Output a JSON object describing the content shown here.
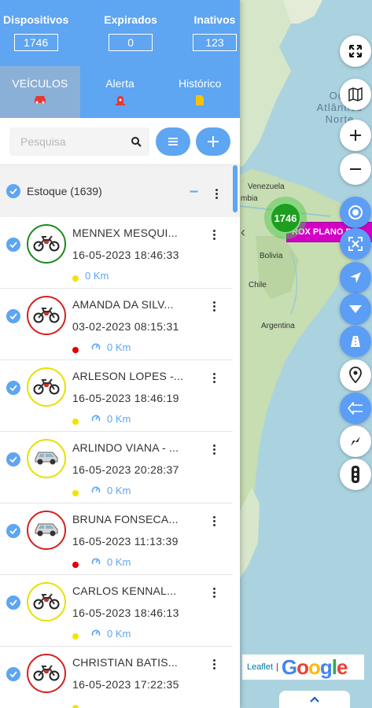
{
  "stats": [
    {
      "label": "Dispositivos",
      "value": "1746"
    },
    {
      "label": "Expirados",
      "value": "0"
    },
    {
      "label": "Inativos",
      "value": "123"
    }
  ],
  "tabs": [
    {
      "label": "VEÍCULOS",
      "icon": "car-icon",
      "color": "#e53935",
      "active": true
    },
    {
      "label": "Alerta",
      "icon": "siren-icon",
      "color": "#e53935",
      "active": false
    },
    {
      "label": "Histórico",
      "icon": "document-icon",
      "color": "#f4c20d",
      "active": false
    }
  ],
  "search": {
    "placeholder": "Pesquisa",
    "value": ""
  },
  "group": {
    "label": "Estoque (1639)"
  },
  "vehicles": [
    {
      "name": "MENNEX MESQUI...",
      "datetime": "16-05-2023 18:46:33",
      "speed": "0 Km",
      "status_color": "#f2e400",
      "ring_color": "#1b8a1b",
      "vehicle_icon": "motorcycle-icon",
      "show_speed_icon": false
    },
    {
      "name": "AMANDA DA SILV...",
      "datetime": "03-02-2023 08:15:31",
      "speed": "0 Km",
      "status_color": "#e00000",
      "ring_color": "#d61f1f",
      "vehicle_icon": "motorcycle-icon",
      "show_speed_icon": true
    },
    {
      "name": "ARLESON LOPES -...",
      "datetime": "16-05-2023 18:46:19",
      "speed": "0 Km",
      "status_color": "#f2e400",
      "ring_color": "#e8e000",
      "vehicle_icon": "motorcycle-icon",
      "show_speed_icon": true
    },
    {
      "name": "ARLINDO VIANA - ...",
      "datetime": "16-05-2023 20:28:37",
      "speed": "0 Km",
      "status_color": "#f2e400",
      "ring_color": "#e8e000",
      "vehicle_icon": "car-icon",
      "show_speed_icon": true
    },
    {
      "name": "BRUNA FONSECA...",
      "datetime": "16-05-2023 11:13:39",
      "speed": "0 Km",
      "status_color": "#e00000",
      "ring_color": "#d61f1f",
      "vehicle_icon": "car-icon",
      "show_speed_icon": true
    },
    {
      "name": "CARLOS KENNAL...",
      "datetime": "16-05-2023 18:46:13",
      "speed": "0 Km",
      "status_color": "#f2e400",
      "ring_color": "#e8e000",
      "vehicle_icon": "motorcycle-icon",
      "show_speed_icon": true
    },
    {
      "name": "CHRISTIAN BATIS...",
      "datetime": "16-05-2023 17:22:35",
      "speed": "",
      "status_color": "#f2e400",
      "ring_color": "#d61f1f",
      "vehicle_icon": "motorcycle-icon",
      "show_speed_icon": false
    }
  ],
  "map": {
    "ocean_label": "Oce Atlântico Norte",
    "countries": [
      "Venezuela",
      "mbia",
      "Bolivia",
      "Chile",
      "Argentina"
    ],
    "cluster_count": "1746",
    "marker_label": "ROX PLANO RO",
    "attribution": {
      "leaflet": "Leaflet",
      "separator": "|",
      "google": "Google"
    },
    "controls": [
      {
        "icon": "fullscreen-icon",
        "style": "white"
      },
      {
        "icon": "map-layers-icon",
        "style": "white"
      },
      {
        "icon": "zoom-in-icon",
        "style": "white"
      },
      {
        "icon": "zoom-out-icon",
        "style": "white"
      },
      {
        "icon": "target-icon",
        "style": "blue"
      },
      {
        "icon": "fit-bounds-icon",
        "style": "blue"
      },
      {
        "icon": "navigation-icon",
        "style": "blue"
      },
      {
        "icon": "filter-icon",
        "style": "blue"
      },
      {
        "icon": "road-icon",
        "style": "blue"
      },
      {
        "icon": "location-pin-icon",
        "style": "white"
      },
      {
        "icon": "route-arrow-icon",
        "style": "blue"
      },
      {
        "icon": "compass-icon",
        "style": "white"
      },
      {
        "icon": "traffic-light-icon",
        "style": "white"
      }
    ]
  },
  "colors": {
    "accent": "#5ea5f2",
    "active_tab": "#8bb0d7"
  }
}
